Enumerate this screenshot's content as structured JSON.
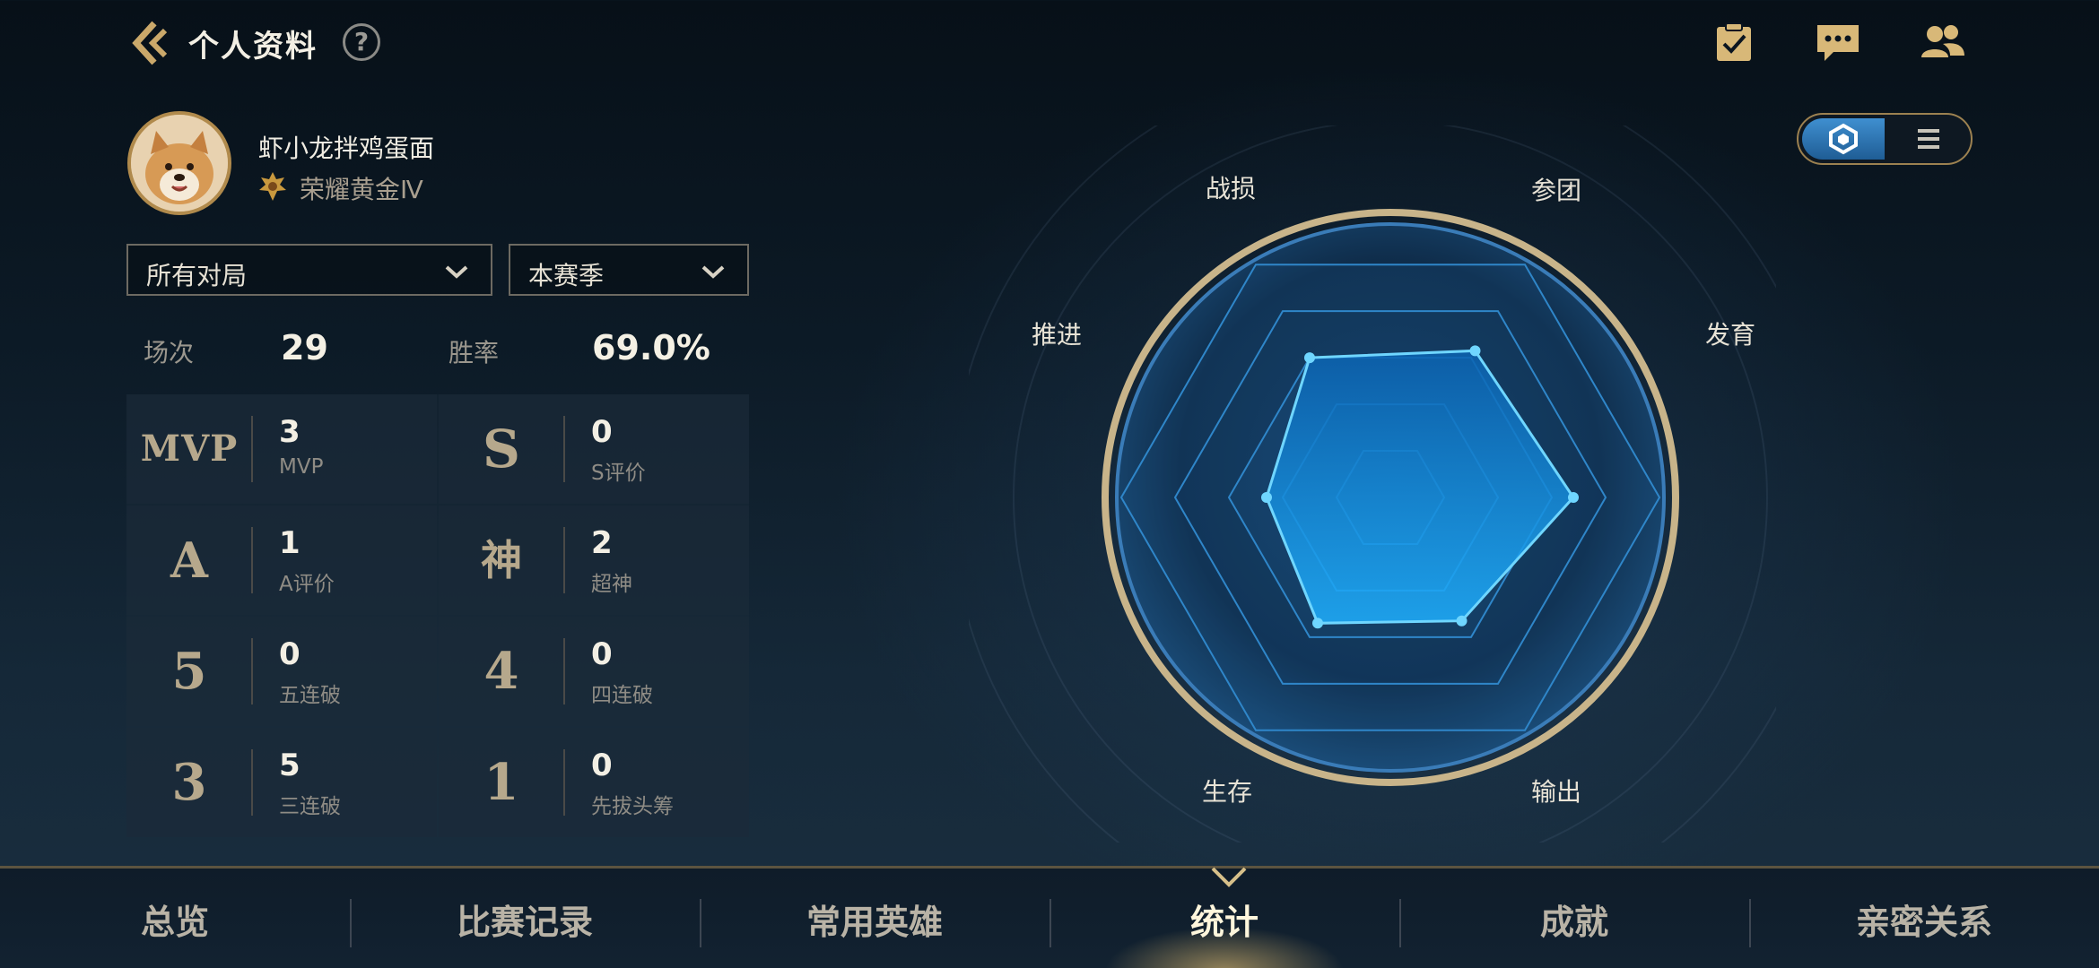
{
  "header": {
    "title": "个人资料",
    "help_label": "?"
  },
  "top_icons": [
    "task-icon",
    "chat-icon",
    "friends-icon"
  ],
  "profile": {
    "nickname": "虾小龙拌鸡蛋面",
    "rank": "荣耀黄金Ⅳ"
  },
  "filters": {
    "mode": "所有对局",
    "season": "本赛季"
  },
  "summary": {
    "games_label": "场次",
    "games_value": "29",
    "winrate_label": "胜率",
    "winrate_value": "69.0%"
  },
  "stats": [
    {
      "badge": "MVP",
      "value": "3",
      "label": "MVP"
    },
    {
      "badge": "S",
      "value": "0",
      "label": "S评价"
    },
    {
      "badge": "A",
      "value": "1",
      "label": "A评价"
    },
    {
      "badge": "神",
      "value": "2",
      "label": "超神"
    },
    {
      "badge": "5",
      "value": "0",
      "label": "五连破"
    },
    {
      "badge": "4",
      "value": "0",
      "label": "四连破"
    },
    {
      "badge": "3",
      "value": "5",
      "label": "三连破"
    },
    {
      "badge": "1",
      "value": "0",
      "label": "先拔头筹"
    }
  ],
  "radar": {
    "axes": [
      "战损",
      "参团",
      "发育",
      "输出",
      "生存",
      "推进"
    ],
    "values": [
      0.6,
      0.63,
      0.68,
      0.53,
      0.54,
      0.46
    ],
    "colors": {
      "fill": "#1aa3ff",
      "stroke": "#6fd6ff",
      "ring": "#c8b48a"
    }
  },
  "view_toggle": {
    "active": "radar"
  },
  "side_id": "13384552",
  "tabs": [
    "总览",
    "比赛记录",
    "常用英雄",
    "统计",
    "成就",
    "亲密关系"
  ],
  "active_tab": "统计"
}
